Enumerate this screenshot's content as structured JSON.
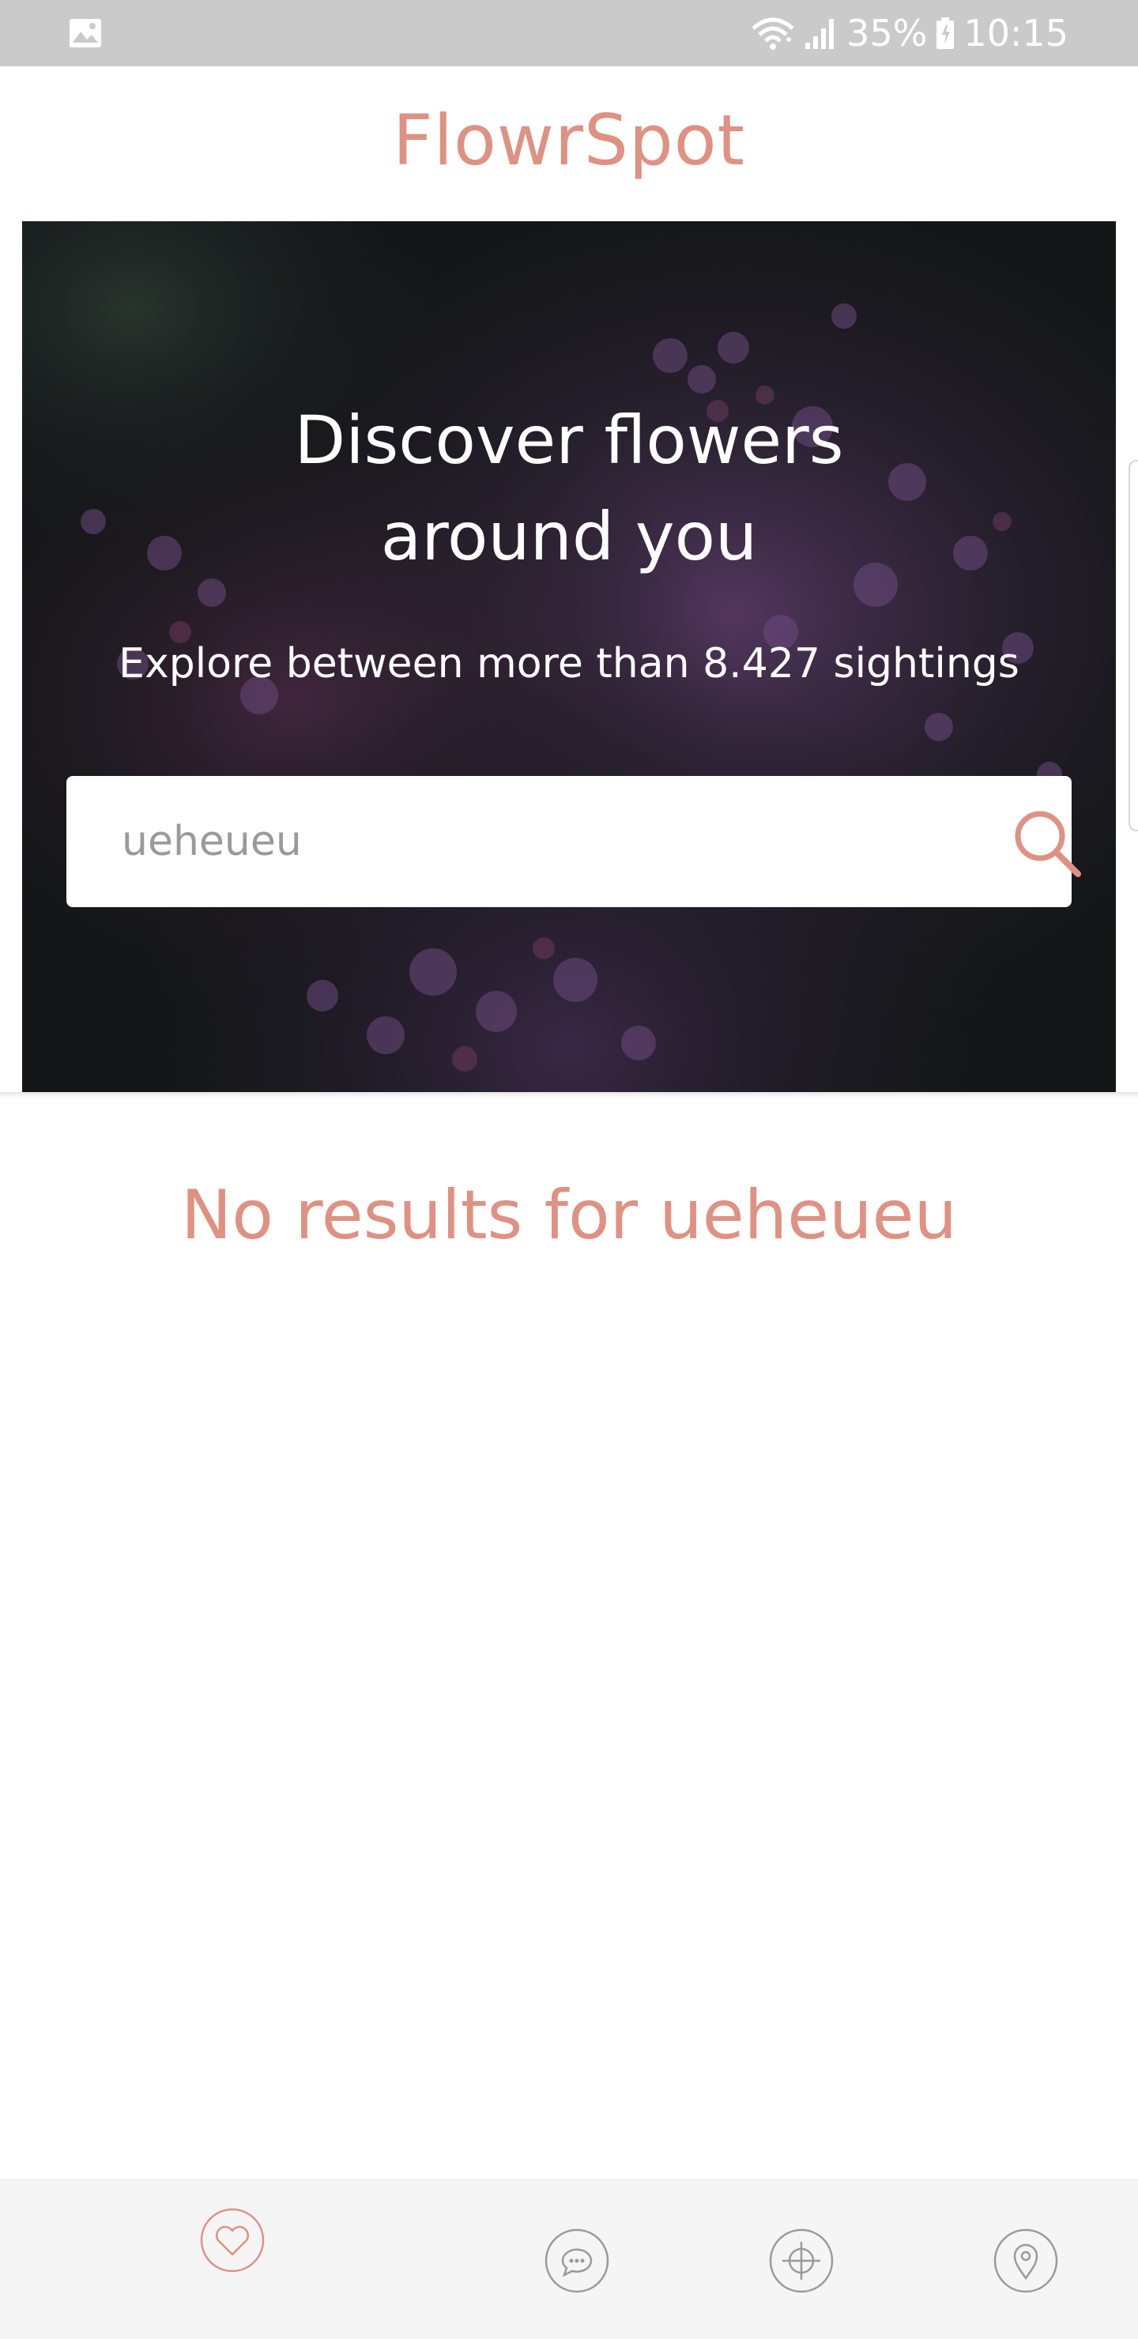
{
  "status_bar": {
    "battery_percent": "35%",
    "time": "10:15",
    "icons": [
      "gallery-icon",
      "wifi-icon",
      "signal-icon",
      "battery-icon"
    ]
  },
  "header": {
    "title": "FlowrSpot"
  },
  "hero": {
    "title_line1": "Discover flowers",
    "title_line2": "around you",
    "subtitle": "Explore between more than 8.427 sightings"
  },
  "search": {
    "value": "ueheueu",
    "icon": "search-icon"
  },
  "results": {
    "message": "No results for ueheueu"
  },
  "bottom_nav": {
    "items": [
      {
        "icon": "heart-icon",
        "active": true
      },
      {
        "icon": "comment-icon",
        "active": false
      },
      {
        "icon": "crosshair-icon",
        "active": false
      },
      {
        "icon": "location-pin-icon",
        "active": false
      }
    ]
  },
  "colors": {
    "accent": "#df9182",
    "status_bar": "#cacaca",
    "nav_background": "#f5f5f5",
    "nav_icon_inactive": "#9a9a9a"
  }
}
